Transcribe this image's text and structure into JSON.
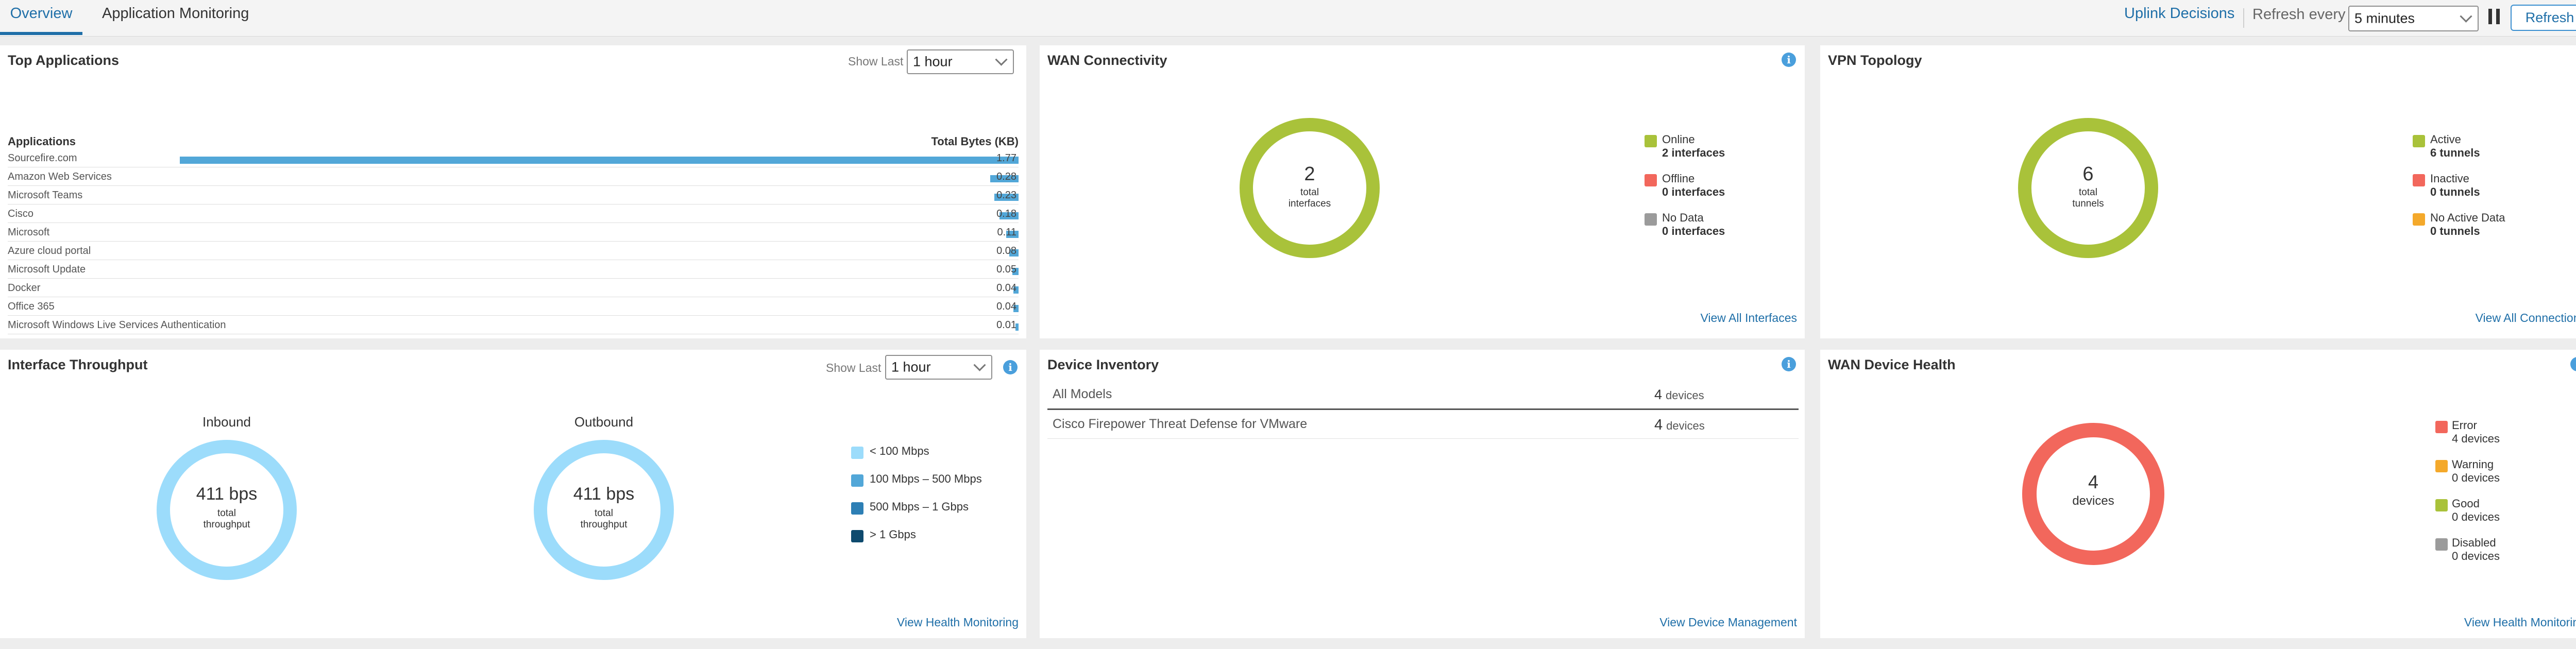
{
  "tabs": [
    {
      "label": "Overview",
      "active": true
    },
    {
      "label": "Application Monitoring",
      "active": false
    }
  ],
  "toolbar": {
    "uplink_decisions": "Uplink Decisions",
    "refresh_every_label": "Refresh every",
    "refresh_interval": "5 minutes",
    "refresh_button": "Refresh"
  },
  "top_applications": {
    "title": "Top Applications",
    "show_last_label": "Show Last",
    "show_last_value": "1 hour",
    "col_app": "Applications",
    "col_bytes": "Total Bytes (KB)",
    "rows": [
      {
        "name": "Sourcefire.com",
        "value": "1.77",
        "fraction": 0.83
      },
      {
        "name": "Amazon Web Services",
        "value": "0.28",
        "fraction": 0.028
      },
      {
        "name": "Microsoft Teams",
        "value": "0.23",
        "fraction": 0.024
      },
      {
        "name": "Cisco",
        "value": "0.18",
        "fraction": 0.019
      },
      {
        "name": "Microsoft",
        "value": "0.11",
        "fraction": 0.012
      },
      {
        "name": "Azure cloud portal",
        "value": "0.08",
        "fraction": 0.009
      },
      {
        "name": "Microsoft Update",
        "value": "0.05",
        "fraction": 0.006
      },
      {
        "name": "Docker",
        "value": "0.04",
        "fraction": 0.005
      },
      {
        "name": "Office 365",
        "value": "0.04",
        "fraction": 0.005
      },
      {
        "name": "Microsoft Windows Live Services Authentication",
        "value": "0.01",
        "fraction": 0.002
      }
    ]
  },
  "wan_connectivity": {
    "title": "WAN Connectivity",
    "count": "2",
    "center_label_1": "total",
    "center_label_2": "interfaces",
    "ring_color": "#a9c23a",
    "legend": [
      {
        "label": "Online",
        "value": "2 interfaces",
        "color": "#a9c23a"
      },
      {
        "label": "Offline",
        "value": "0 interfaces",
        "color": "#f2675c"
      },
      {
        "label": "No Data",
        "value": "0 interfaces",
        "color": "#9b9b9b"
      }
    ],
    "link": "View All Interfaces"
  },
  "vpn_topology": {
    "title": "VPN Topology",
    "count": "6",
    "center_label_1": "total",
    "center_label_2": "tunnels",
    "ring_color": "#a9c23a",
    "legend": [
      {
        "label": "Active",
        "value": "6 tunnels",
        "color": "#a9c23a"
      },
      {
        "label": "Inactive",
        "value": "0 tunnels",
        "color": "#f2675c"
      },
      {
        "label": "No Active Data",
        "value": "0 tunnels",
        "color": "#f4a92b"
      }
    ],
    "link": "View All Connections"
  },
  "interface_throughput": {
    "title": "Interface Throughput",
    "show_last_label": "Show Last",
    "show_last_value": "1 hour",
    "inbound": {
      "title": "Inbound",
      "value": "411 bps",
      "label_1": "total",
      "label_2": "throughput"
    },
    "outbound": {
      "title": "Outbound",
      "value": "411 bps",
      "label_1": "total",
      "label_2": "throughput"
    },
    "ring_color": "#9cdcfb",
    "legend": [
      {
        "label": "< 100 Mbps",
        "color": "#9cdcfb"
      },
      {
        "label": "100 Mbps – 500 Mbps",
        "color": "#52a7d8"
      },
      {
        "label": "500 Mbps – 1 Gbps",
        "color": "#2d7fb5"
      },
      {
        "label": "> 1 Gbps",
        "color": "#0e4a6e"
      }
    ],
    "link": "View Health Monitoring"
  },
  "device_inventory": {
    "title": "Device Inventory",
    "rows": [
      {
        "model": "All Models",
        "count": "4",
        "unit": "devices"
      },
      {
        "model": "Cisco Firepower Threat Defense for VMware",
        "count": "4",
        "unit": "devices"
      }
    ],
    "link": "View Device Management"
  },
  "wan_device_health": {
    "title": "WAN Device Health",
    "count": "4",
    "center_label": "devices",
    "ring_color": "#f2675c",
    "legend": [
      {
        "label": "Error",
        "value": "4 devices",
        "color": "#f2675c"
      },
      {
        "label": "Warning",
        "value": "0 devices",
        "color": "#f4a92b"
      },
      {
        "label": "Good",
        "value": "0 devices",
        "color": "#a9c23a"
      },
      {
        "label": "Disabled",
        "value": "0 devices",
        "color": "#9b9b9b"
      }
    ],
    "link": "View Health Monitoring"
  },
  "icons": {
    "info": "info-icon",
    "chevron": "chevron-down-icon",
    "pause": "pause-icon"
  }
}
